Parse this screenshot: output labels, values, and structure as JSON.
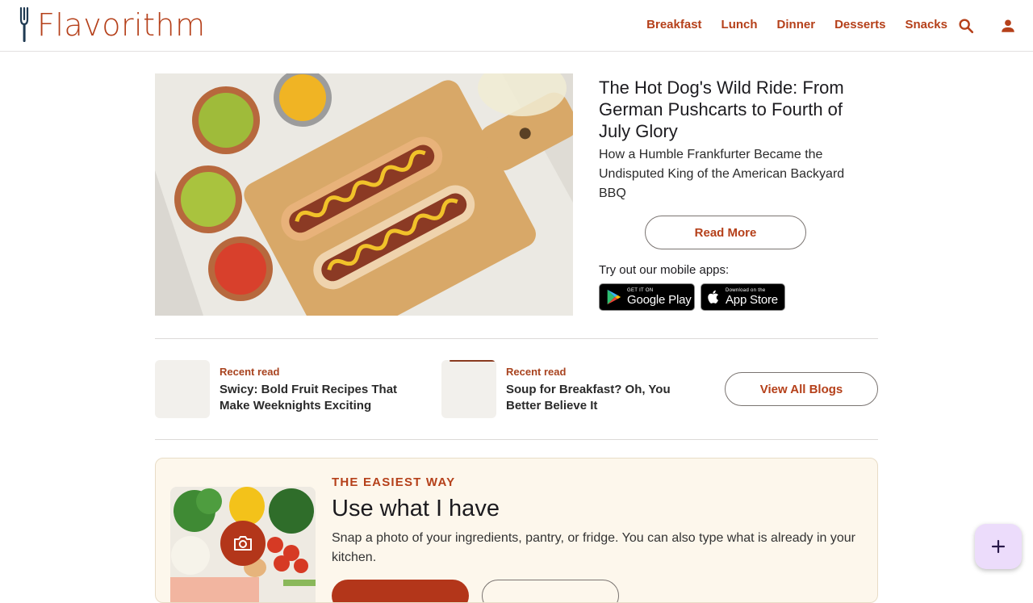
{
  "brand": {
    "name": "Flavorithm",
    "color": "#b5401a"
  },
  "nav": {
    "items": [
      {
        "label": "Breakfast"
      },
      {
        "label": "Lunch"
      },
      {
        "label": "Dinner"
      },
      {
        "label": "Desserts"
      },
      {
        "label": "Snacks"
      }
    ],
    "search_icon": "search-icon",
    "account_icon": "person-icon"
  },
  "hero": {
    "title": "The Hot Dog's Wild Ride: From German Pushcarts to Fourth of July Glory",
    "subtitle": "How a Humble Frankfurter Became the Undisputed King of the American Backyard BBQ",
    "read_more_label": "Read More",
    "apps_label": "Try out our mobile apps:",
    "google_play": {
      "small": "GET IT ON",
      "big": "Google Play"
    },
    "app_store": {
      "small": "Download on the",
      "big": "App Store"
    }
  },
  "recent_reads": {
    "items": [
      {
        "tag": "Recent read",
        "title": "Swicy: Bold Fruit Recipes That Make Weeknights Exciting"
      },
      {
        "tag": "Recent read",
        "title": "Soup for Breakfast? Oh, You Better Believe It"
      }
    ],
    "view_all_label": "View All Blogs"
  },
  "promo": {
    "eyebrow": "THE EASIEST WAY",
    "title": "Use what I have",
    "description": "Snap a photo of your ingredients, pantry, or fridge. You can also type what is already in your kitchen.",
    "camera_icon": "camera-icon"
  },
  "fab": {
    "icon": "plus-icon"
  }
}
